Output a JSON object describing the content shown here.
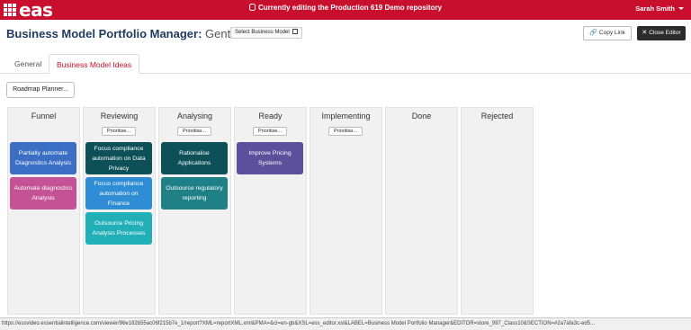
{
  "topbar": {
    "logo_text": "eas",
    "banner": "Currently editing the Production 619 Demo repository",
    "user_name": "Sarah Smith"
  },
  "header": {
    "title": "Business Model Portfolio Manager:",
    "subtitle": "Gentailer",
    "select_model": "Select Business Model",
    "copy_link": "Copy Link",
    "close_editor": "Close Editor"
  },
  "tabs": [
    {
      "label": "General",
      "active": false
    },
    {
      "label": "Business Model Ideas",
      "active": true
    }
  ],
  "roadmap_button": "Roadmap Planner...",
  "prioritise_label": "Prioritise...",
  "columns": [
    {
      "title": "Funnel",
      "prioritise": false,
      "cards": [
        {
          "label": "Partially automate Diagnostics Analysis",
          "color": "#3a6fc4"
        },
        {
          "label": "Automate diagnostics Analysis",
          "color": "#c45294"
        }
      ]
    },
    {
      "title": "Reviewing",
      "prioritise": true,
      "cards": [
        {
          "label": "Focus compliance automation on Data Privacy",
          "color": "#0d5058"
        },
        {
          "label": "Focus compliance automation on Finance",
          "color": "#2f8dd6"
        },
        {
          "label": "Outsource Pricing Analysis Processes",
          "color": "#21b0b8"
        }
      ]
    },
    {
      "title": "Analysing",
      "prioritise": true,
      "cards": [
        {
          "label": "Rationalise Applications",
          "color": "#0d5058"
        },
        {
          "label": "Outsource regulatory reporting",
          "color": "#1f8087"
        }
      ]
    },
    {
      "title": "Ready",
      "prioritise": true,
      "cards": [
        {
          "label": "Improve Pricing Systems",
          "color": "#5c4f9b"
        }
      ]
    },
    {
      "title": "Implementing",
      "prioritise": true,
      "cards": []
    },
    {
      "title": "Done",
      "prioritise": false,
      "cards": []
    },
    {
      "title": "Rejected",
      "prioritise": false,
      "cards": []
    }
  ],
  "status_url": "https://essvideo.essentialintelligence.com/viewer/96e182b55ac06f215b7e_1/report?XML=reportXML.xml&PMA=&cl=en-gb&XSL=ess_editor.xsl&LABEL=Business Model Portfolio Manager&EDITOR=store_997_Class10&SECTION=#2a7afa3c-ed5..."
}
